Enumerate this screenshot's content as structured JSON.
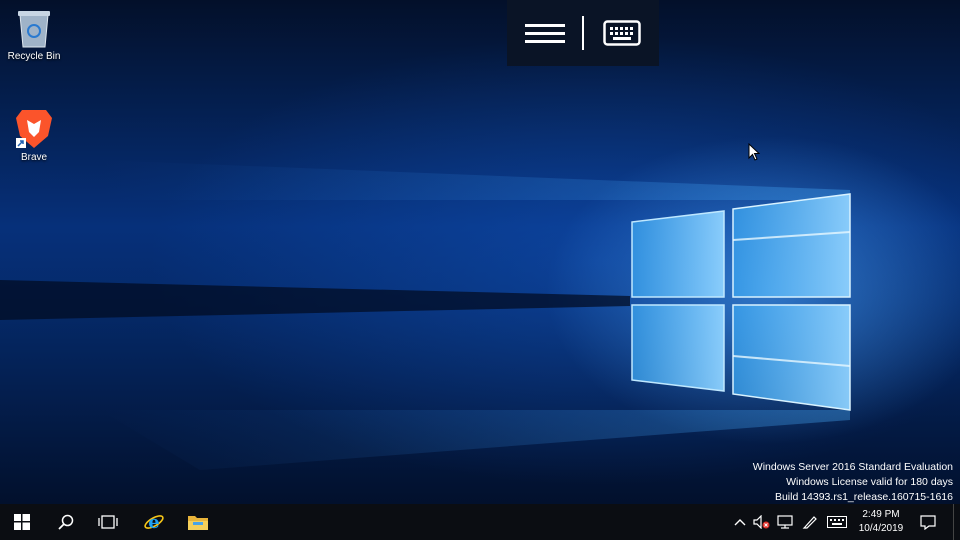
{
  "desktop": {
    "icons": [
      {
        "label": "Recycle Bin",
        "icon": "recycle-bin-icon"
      },
      {
        "label": "Brave",
        "icon": "brave-lion-icon"
      }
    ],
    "watermark": {
      "line1": "Windows Server 2016 Standard Evaluation",
      "line2": "Windows License valid for 180 days",
      "line3": "Build 14393.rs1_release.160715-1616"
    }
  },
  "osk_bar": {
    "menu_icon": "hamburger-menu-icon",
    "keyboard_icon": "keyboard-icon"
  },
  "taskbar": {
    "buttons": [
      "windows-start-icon",
      "search-icon",
      "task-view-icon",
      "internet-explorer-icon",
      "file-explorer-icon"
    ],
    "tray": {
      "icons": [
        "chevron-up-icon",
        "speaker-muted-icon",
        "network-icon",
        "pen-icon",
        "keyboard-icon",
        "action-center-icon"
      ],
      "time": "2:49 PM",
      "date": "10/4/2019"
    }
  },
  "colors": {
    "taskbar": "#0b0d12",
    "accent": "#1e90ff",
    "wallpaper_dark": "#02102c"
  }
}
